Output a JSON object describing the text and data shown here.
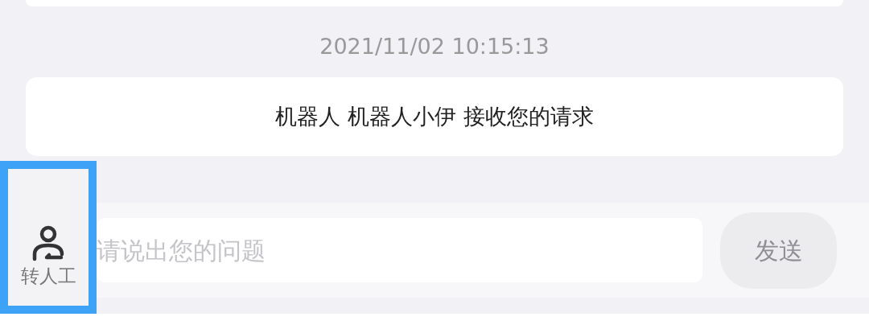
{
  "timestamp": "2021/11/02 10:15:13",
  "message": {
    "text": "机器人 机器人小伊 接收您的请求"
  },
  "transfer_button": {
    "label": "转人工",
    "highlighted": true
  },
  "input": {
    "placeholder": "请说出您的问题"
  },
  "send_button": {
    "label": "发送",
    "disabled": true
  }
}
